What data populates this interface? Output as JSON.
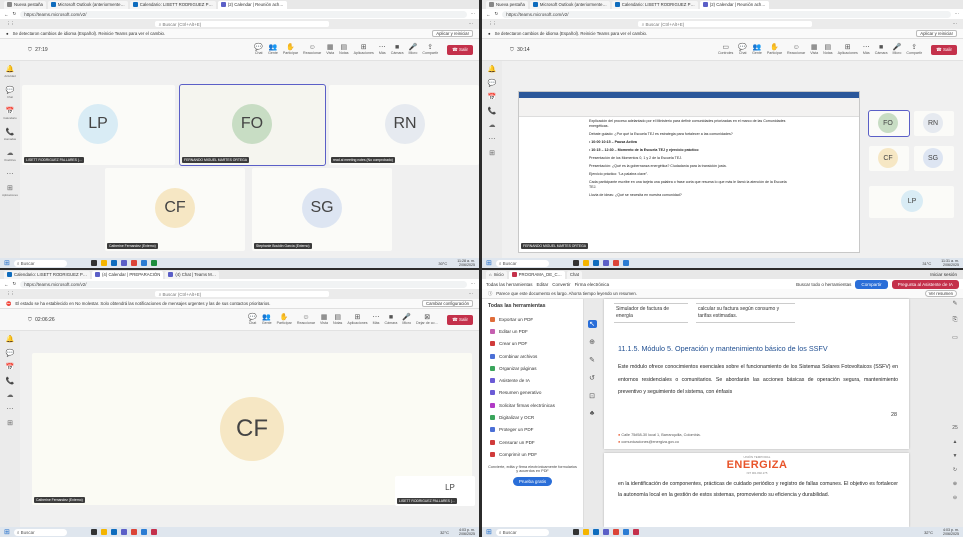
{
  "tl": {
    "tabs": [
      "Nueva pestaña",
      "Microsoft Outlook (anteriormente…",
      "Calendario: LISETT RODRIGUEZ P…",
      "(2) Calendar | Reunión ach…"
    ],
    "url": "https://teams.microsoft.com/v2/",
    "search": "Buscar (Ctrl+Alt+E)",
    "notice": "Se detectaron cambios de idioma (Español). Reinicie Teams para ver el cambio.",
    "notice_action": "Aplicar y reiniciar",
    "timer": "27:19",
    "controls": [
      "Chat",
      "Gente",
      "Participar",
      "Reaccionar",
      "Vista",
      "Notas",
      "Aplicaciones",
      "Más",
      "Cámara",
      "Micro",
      "Compartir"
    ],
    "leave": "Salir",
    "tooltip": "Reactivar audio del micrófono (Ctrl+Mayús+M)",
    "participants": [
      {
        "initials": "LP",
        "name": "LISETT RODRIGUEZ PALLARES (…"
      },
      {
        "initials": "FO",
        "name": "FERNANDO MIGUEL MARTES ORTEGA"
      },
      {
        "initials": "RN",
        "name": "read.ai meeting notes (No comprobado)"
      },
      {
        "initials": "CF",
        "name": "Catherine Fernandez (Externo)"
      },
      {
        "initials": "SG",
        "name": "Stephanie Bouldin García (Externo)"
      }
    ],
    "taskbar": {
      "search": "Buscar",
      "weather": "30°C",
      "time": "11:28 a. m.",
      "date": "2/06/2025"
    }
  },
  "tr": {
    "tabs": [
      "Nueva pestaña",
      "Microsoft Outlook (anteriormente…",
      "Calendario: LISETT RODRIGUEZ P…",
      "(2) Calendar | Reunión ach…"
    ],
    "url": "https://teams.microsoft.com/v2/",
    "search": "Buscar (Ctrl+Alt+E)",
    "notice": "Se detectaron cambios de idioma (Español). Reinicie Teams para ver el cambio.",
    "notice_action": "Aplicar y reiniciar",
    "timer": "30:14",
    "controls": [
      "Controles",
      "Chat",
      "Gente",
      "Participar",
      "Reaccionar",
      "Vista",
      "Notas",
      "Aplicaciones",
      "Más",
      "Cámara",
      "Micro",
      "Compartir"
    ],
    "leave": "Salir",
    "doc_paragraphs": [
      "Explicación del proceso adelantado por el Ministerio para definir comunidades priorizadas en el marco de las Comunidades energéticas.",
      "Debate guiado: ¿Por qué la Escuela TEJ es estrategia para fortalecer a las comunidades?",
      "• 10:00 10:15 – Pausa Activa",
      "• 10:15 – 12:30 – Momento de la Escuela TEJ y ejercicio práctico",
      "Presentación de los Momentos 0, 1 y 2 de la Escuela TEJ.",
      "Presentación: ¿Qué es la gobernanza energética? Ciudadanía para la transición justa.",
      "Ejercicio práctico: \"La palabra clave\".",
      "Cada participante escribe en una tarjeta una palabra o frase corta que resuma lo que más le llamó la atención de la Escuela TEJ.",
      "Lluvia de ideas: ¿Qué se necesita en nuestra comunidad?"
    ],
    "doc_speaker": "FERNANDO MIGUEL MARTES ORTEGA",
    "side": [
      {
        "initials": "FO"
      },
      {
        "initials": "RN"
      },
      {
        "initials": "CF"
      },
      {
        "initials": "SG"
      },
      {
        "initials": "LP"
      }
    ],
    "taskbar": {
      "search": "Buscar",
      "weather": "31°C",
      "time": "11:31 a. m.",
      "date": "2/06/2025"
    }
  },
  "bl": {
    "tabs": [
      "Calendario: LISETT RODRIGUEZ P…",
      "(4) Calendar | PREPARACIÓN",
      "(4) Chat | Teams M…"
    ],
    "url": "https://teams.microsoft.com/v2/",
    "search": "Buscar (Ctrl+Alt+E)",
    "notice": "El estado se ha establecido en No molestar. Solo obtendrá las notificaciones de mensajes urgentes y las de sus contactos prioritarios.",
    "notice_action": "Cambiar configuración",
    "timer": "02:06:26",
    "controls": [
      "Chat",
      "Gente",
      "Participar",
      "Reaccionar",
      "Vista",
      "Notas",
      "Aplicaciones",
      "Más",
      "Cámara",
      "Micro",
      "Dejar de co…"
    ],
    "leave": "Salir",
    "main": {
      "initials": "CF",
      "name": "Catherine Fernandez (Externo)"
    },
    "pip": {
      "initials": "LP",
      "name": "LISETT RODRIGUEZ PALLARES (…"
    },
    "taskbar": {
      "search": "Buscar",
      "weather": "32°C",
      "time": "4:03 p. m.",
      "date": "2/06/2025"
    }
  },
  "br": {
    "tabs": [
      "Inicio",
      "PROGRAMA_DE_C…",
      "Chat"
    ],
    "menu": [
      "Todas las herramientas",
      "Editar",
      "Convertir",
      "Firma electrónica"
    ],
    "search_tools": "Buscar todo o herramientas",
    "share": "Compartir",
    "ai": "Pregunta al Asistente de IA",
    "signin": "Iniciar sesión",
    "notice": "Parece que este documento es largo. Ahorra tiempo leyendo un resumen.",
    "summary_btn": "Ver resumen",
    "panel_title": "Todas las herramientas",
    "tools": [
      "Exportar un PDF",
      "Editar un PDF",
      "Crear un PDF",
      "Combinar archivos",
      "Organizar páginas",
      "Asistente de IA",
      "Resumen generativo",
      "Solicitar firmas electrónicas",
      "Digitalizar y OCR",
      "Proteger un PDF",
      "Censurar un PDF",
      "Comprimir un PDF"
    ],
    "promo": "Convierte, edita y firma electrónicamente formularios y acuerdos en PDF",
    "trial": "Prueba gratis",
    "table_left": "Simulador de factura de energía",
    "table_right": "calcular su factura según consumo y tarifas estimadas.",
    "heading": "11.1.5. Módulo 5. Operación y mantenimiento básico de los SSFV",
    "body": "Este módulo ofrece conocimientos esenciales sobre el funcionamiento de los Sistemas Solares Fotovoltaicos (SSFV) en entornos residenciales o comunitarios. Se abordarán las acciones básicas de operación segura, mantenimiento preventivo y seguimiento del sistema, con énfasis",
    "page_no": "28",
    "address": "Calle 75#58-30 local 1, Barranquilla, Colombia.",
    "email": "comunicaciones@energiza.gov.co",
    "logo_top": "UNIÓN TEMPORAL",
    "logo": "ENERGIZA",
    "logo_sub": "NIT 901.892.275",
    "page2": "en la identificación de componentes, prácticas de cuidado periódico y registro de fallas comunes. El objetivo es fortalecer la autonomía local en la gestión de estos sistemas, promoviendo su eficiencia y durabilidad.",
    "zoom": "25",
    "taskbar": {
      "search": "Buscar",
      "weather": "32°C",
      "time": "4:03 p. m.",
      "date": "2/06/2025"
    }
  },
  "colors": {
    "teams": "#5b5fc7",
    "leave": "#c4314b",
    "accent": "#2a6ed8",
    "energiza": "#e8542a"
  }
}
